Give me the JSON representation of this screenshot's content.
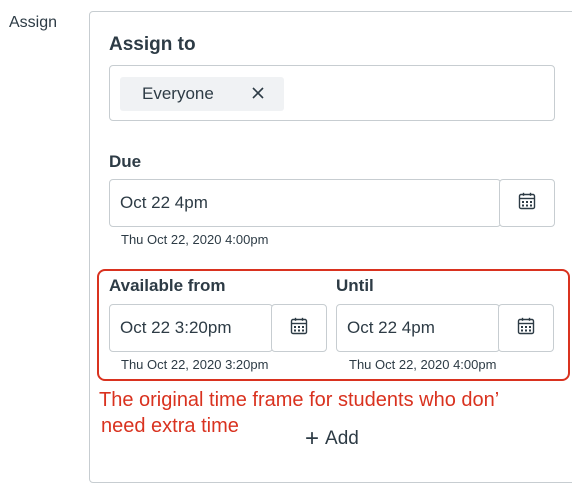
{
  "section": {
    "label": "Assign"
  },
  "assign_to": {
    "heading": "Assign to",
    "chip_label": "Everyone"
  },
  "due": {
    "label": "Due",
    "value": "Oct 22 4pm",
    "helper": "Thu Oct 22, 2020 4:00pm"
  },
  "available_from": {
    "label": "Available from",
    "value": "Oct 22 3:20pm",
    "helper": "Thu Oct 22, 2020 3:20pm"
  },
  "until": {
    "label": "Until",
    "value": "Oct 22 4pm",
    "helper": "Thu Oct 22, 2020 4:00pm"
  },
  "annotation": {
    "line1": "The original time frame for students who don’",
    "line2": "need extra time",
    "color": "#d9321f"
  },
  "add_button": {
    "label": "Add"
  },
  "icons": {
    "remove": "close-icon",
    "calendar": "calendar-icon",
    "add": "plus-icon"
  }
}
